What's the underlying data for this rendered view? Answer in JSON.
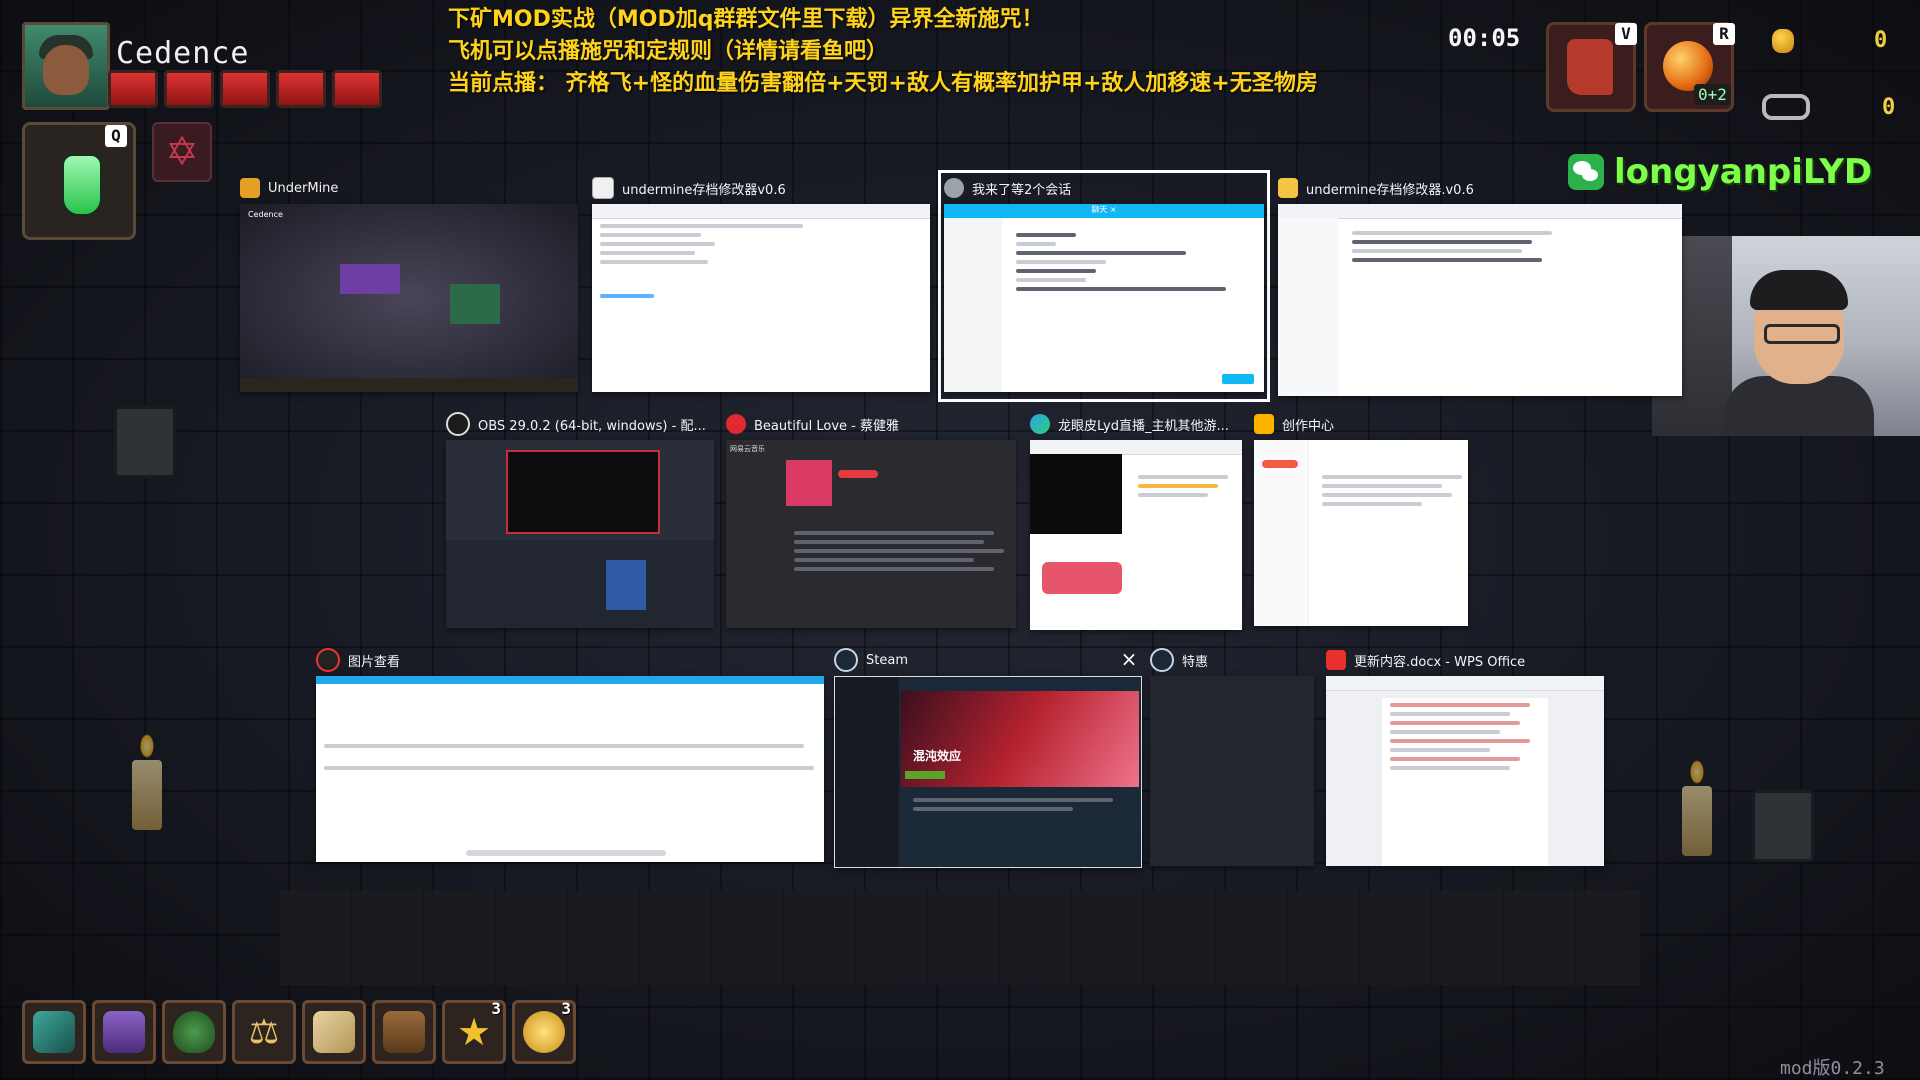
{
  "hud": {
    "player_name": "Cedence",
    "potion_key": "Q",
    "timer": "00:05",
    "boots_key": "V",
    "bomb_key": "R",
    "bomb_count": "0+2",
    "gold": "0",
    "keys": "0",
    "hearts": [
      1,
      1,
      1,
      1,
      1
    ]
  },
  "announcement": {
    "line1": "下矿MOD实战（MOD加q群群文件里下载）异界全新施咒！",
    "line2": "飞机可以点播施咒和定规则（详情请看鱼吧）",
    "line3": "当前点播：  齐格飞+怪的血量伤害翻倍+天罚+敌人有概率加护甲+敌人加移速+无圣物房"
  },
  "wechat": {
    "id": "longyanpiLYD"
  },
  "switcher": {
    "undermine": {
      "title": "UnderMine",
      "thumb_name": "Cedence"
    },
    "savetool1": {
      "title": "undermine存档修改器v0.6"
    },
    "chat": {
      "title": "我来了等2个会话",
      "tab_label": "聊天 ×"
    },
    "savetool2": {
      "title": "undermine存档修改器.v0.6"
    },
    "obs": {
      "title": "OBS 29.0.2 (64-bit, windows) - 配..."
    },
    "music": {
      "title": "Beautiful Love - 蔡健雅",
      "app_name": "网易云音乐"
    },
    "douyu": {
      "title": "龙眼皮Lyd直播_主机其他游..."
    },
    "creator": {
      "title": "创作中心"
    },
    "photo": {
      "title": "图片查看"
    },
    "steam": {
      "title": "Steam",
      "close_symbol": "×",
      "hero_text": "混沌效应"
    },
    "special": {
      "title": "特惠"
    },
    "wps": {
      "title": "更新内容.docx - WPS Office"
    }
  },
  "inventory": {
    "slots": [
      {
        "icon": "green-cannon-icon",
        "count": ""
      },
      {
        "icon": "purple-chest-icon",
        "count": ""
      },
      {
        "icon": "green-sack-icon",
        "count": ""
      },
      {
        "icon": "scales-icon",
        "count": ""
      },
      {
        "icon": "map-scroll-icon",
        "count": ""
      },
      {
        "icon": "book-icon",
        "count": ""
      },
      {
        "icon": "star-relic-icon",
        "count": "3"
      },
      {
        "icon": "gold-coin-relic-icon",
        "count": "3"
      }
    ]
  },
  "version": "mod版0.2.3",
  "colors": {
    "announcement": "#ffd21c",
    "wechat_id": "#7dff4a",
    "heart": "#e03333",
    "potion": "#27c44a"
  }
}
